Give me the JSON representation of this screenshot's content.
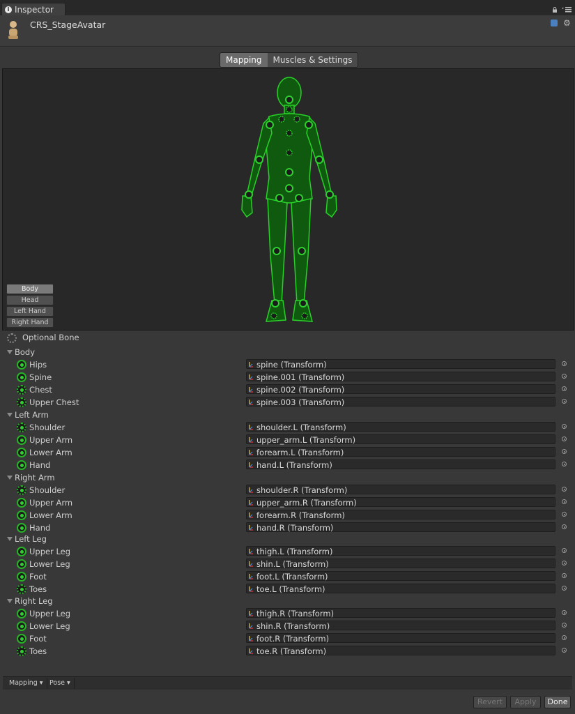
{
  "tab": {
    "title": "Inspector"
  },
  "header": {
    "object_name": "CRS_StageAvatar"
  },
  "toggle": {
    "mapping": "Mapping",
    "muscles": "Muscles & Settings"
  },
  "viewport": {
    "buttons": [
      "Body",
      "Head",
      "Left Hand",
      "Right Hand"
    ]
  },
  "legend": {
    "optional": "Optional Bone"
  },
  "groups": [
    {
      "name": "Body",
      "bones": [
        {
          "label": "Hips",
          "value": "spine (Transform)",
          "optional": false
        },
        {
          "label": "Spine",
          "value": "spine.001 (Transform)",
          "optional": false
        },
        {
          "label": "Chest",
          "value": "spine.002 (Transform)",
          "optional": true
        },
        {
          "label": "Upper Chest",
          "value": "spine.003 (Transform)",
          "optional": true
        }
      ]
    },
    {
      "name": "Left Arm",
      "bones": [
        {
          "label": "Shoulder",
          "value": "shoulder.L (Transform)",
          "optional": true
        },
        {
          "label": "Upper Arm",
          "value": "upper_arm.L (Transform)",
          "optional": false
        },
        {
          "label": "Lower Arm",
          "value": "forearm.L (Transform)",
          "optional": false
        },
        {
          "label": "Hand",
          "value": "hand.L (Transform)",
          "optional": false
        }
      ]
    },
    {
      "name": "Right Arm",
      "bones": [
        {
          "label": "Shoulder",
          "value": "shoulder.R (Transform)",
          "optional": true
        },
        {
          "label": "Upper Arm",
          "value": "upper_arm.R (Transform)",
          "optional": false
        },
        {
          "label": "Lower Arm",
          "value": "forearm.R (Transform)",
          "optional": false
        },
        {
          "label": "Hand",
          "value": "hand.R (Transform)",
          "optional": false
        }
      ]
    },
    {
      "name": "Left Leg",
      "bones": [
        {
          "label": "Upper Leg",
          "value": "thigh.L (Transform)",
          "optional": false
        },
        {
          "label": "Lower Leg",
          "value": "shin.L (Transform)",
          "optional": false
        },
        {
          "label": "Foot",
          "value": "foot.L (Transform)",
          "optional": false
        },
        {
          "label": "Toes",
          "value": "toe.L (Transform)",
          "optional": true
        }
      ]
    },
    {
      "name": "Right Leg",
      "bones": [
        {
          "label": "Upper Leg",
          "value": "thigh.R (Transform)",
          "optional": false
        },
        {
          "label": "Lower Leg",
          "value": "shin.R (Transform)",
          "optional": false
        },
        {
          "label": "Foot",
          "value": "foot.R (Transform)",
          "optional": false
        },
        {
          "label": "Toes",
          "value": "toe.R (Transform)",
          "optional": true
        }
      ]
    }
  ],
  "bottom": {
    "mapping": "Mapping ▾",
    "pose": "Pose ▾"
  },
  "footer": {
    "revert": "Revert",
    "apply": "Apply",
    "done": "Done"
  },
  "colors": {
    "bone_green": "#2fd02f",
    "background": "#383838",
    "viewport": "#282828"
  }
}
